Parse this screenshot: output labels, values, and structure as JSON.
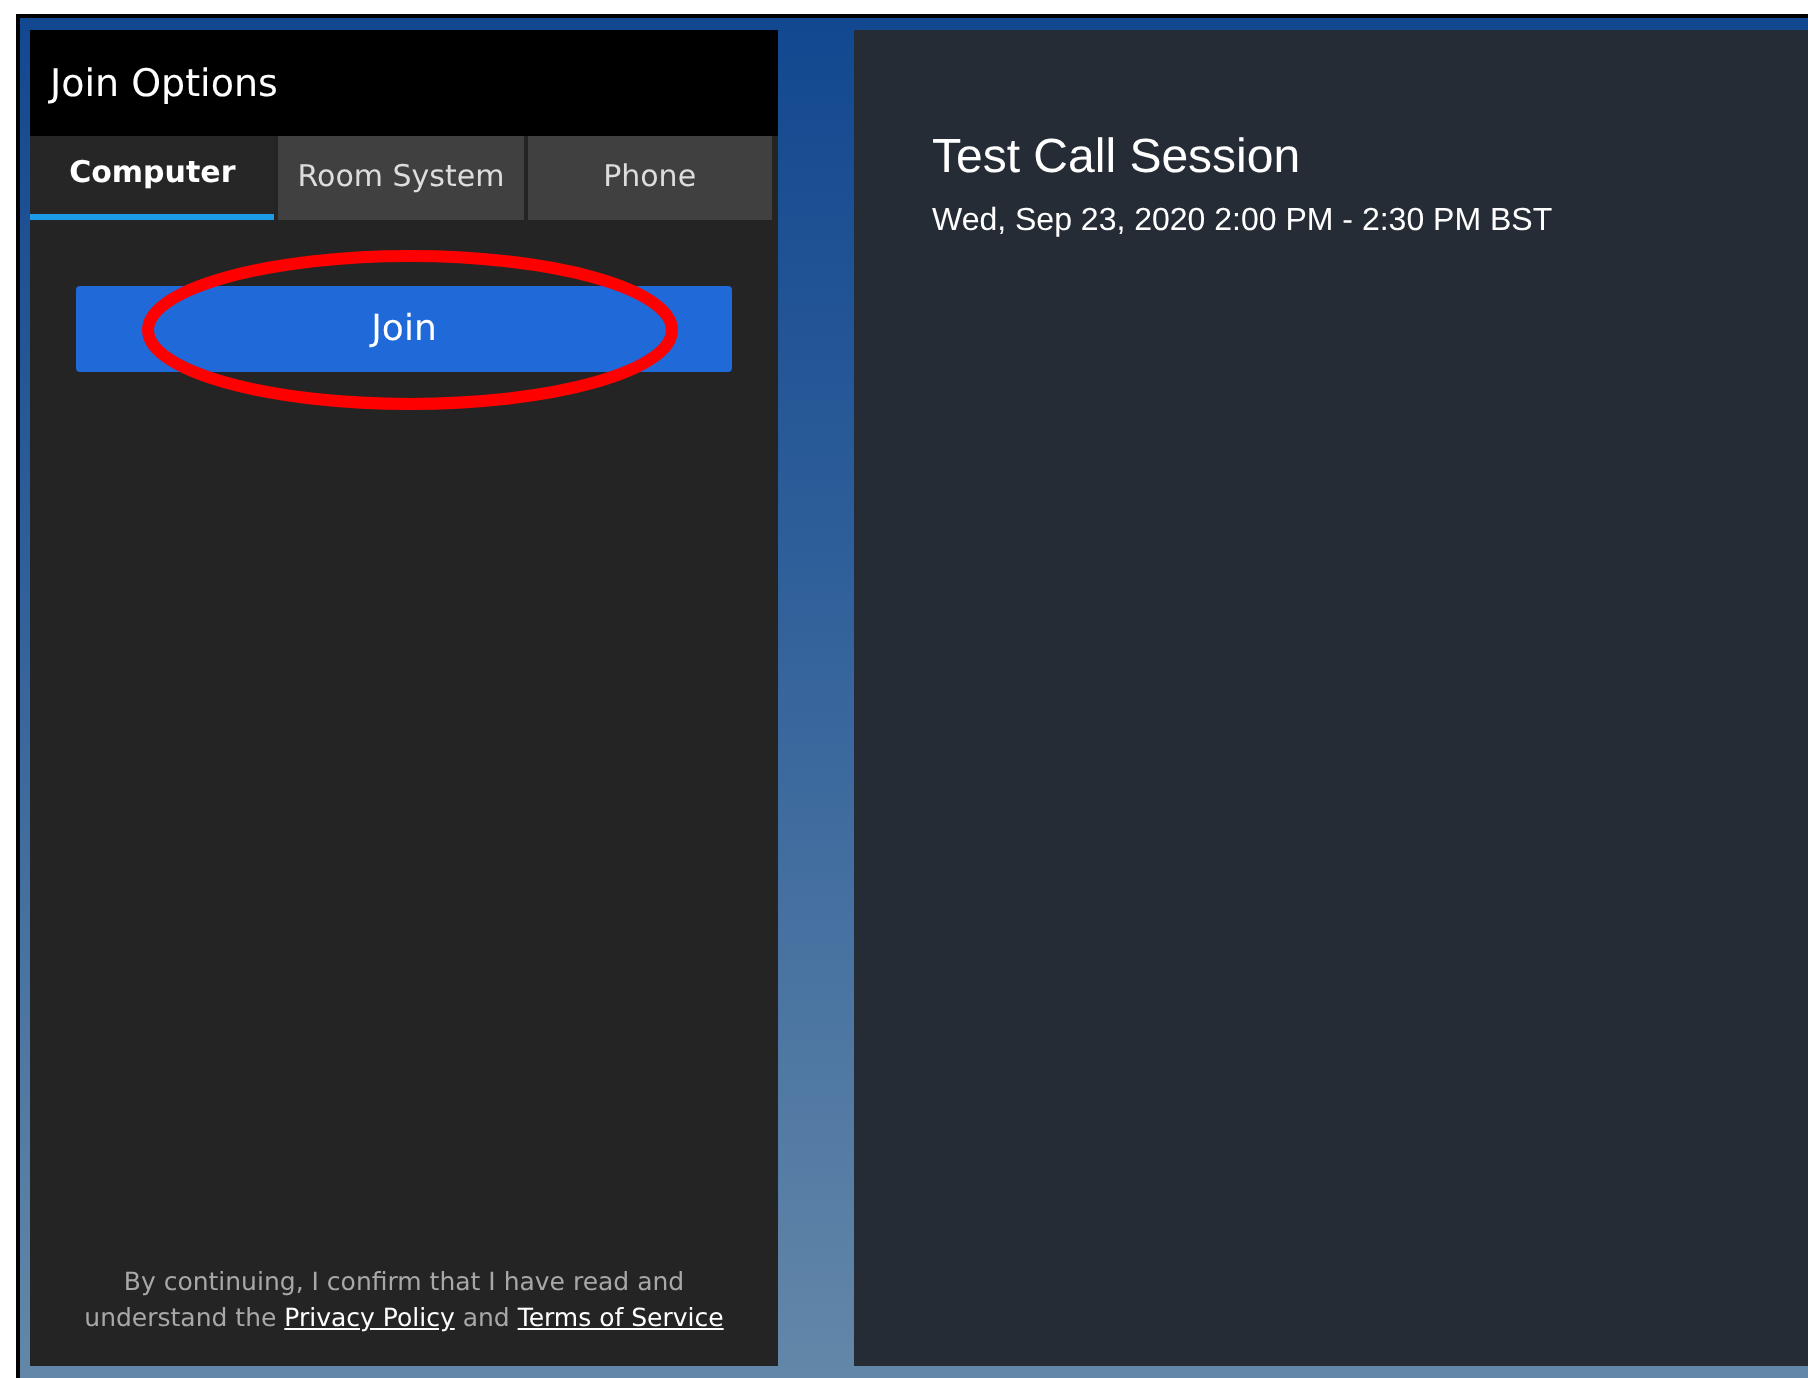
{
  "join_panel": {
    "title": "Join Options",
    "tabs": [
      {
        "label": "Computer",
        "selected": true
      },
      {
        "label": "Room System",
        "selected": false
      },
      {
        "label": "Phone",
        "selected": false
      }
    ],
    "join_button": "Join",
    "annotation": {
      "kind": "ellipse"
    },
    "notice": [
      {
        "kind": "text",
        "text": "By continuing, I confirm that I have read and understand the "
      },
      {
        "kind": "link",
        "text": "Privacy Policy"
      },
      {
        "kind": "text",
        "text": " and "
      },
      {
        "kind": "link",
        "text": "Terms of Service"
      }
    ]
  },
  "session": {
    "title": "Test Call Session",
    "time": "Wed, Sep 23, 2020 2:00 PM - 2:30 PM BST"
  }
}
